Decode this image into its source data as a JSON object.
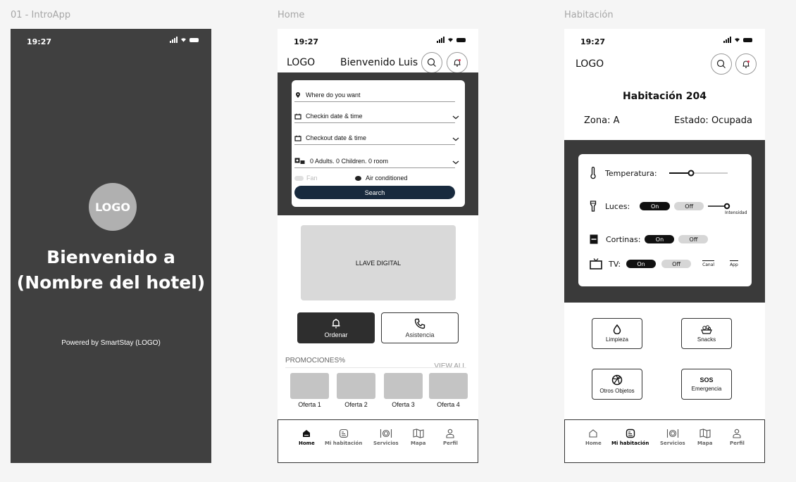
{
  "frames": {
    "intro_label": "01 - IntroApp",
    "home_label": "Home",
    "room_label": "Habitación"
  },
  "status": {
    "time": "19:27"
  },
  "intro": {
    "logo": "LOGO",
    "welcome_line1": "Bienvenido a",
    "welcome_line2": "(Nombre del hotel)",
    "powered": "Powered by SmartStay (LOGO)"
  },
  "home": {
    "logo": "LOGO",
    "welcome": "Bienvenido Luis",
    "search": {
      "where": "Where do you want",
      "checkin": "Checkin date & time",
      "checkout": "Checkout date & time",
      "guests": "0 Adults.   0 Children.   0 room",
      "fan": "Fan",
      "air": "Air conditioned",
      "button": "Search"
    },
    "llave": "LLAVE DIGITAL",
    "ordenar": "Ordenar",
    "asistencia": "Asistencia",
    "promos_title": "PROMOCIONES%",
    "view_all": "VIEW ALL",
    "offers": [
      "Oferta 1",
      "Oferta 2",
      "Oferta 3",
      "Oferta 4"
    ]
  },
  "tabs": [
    "Home",
    "Mi habitación",
    "Servicios",
    "Mapa",
    "Perfil"
  ],
  "room": {
    "logo": "LOGO",
    "title": "Habitación 204",
    "zona": "Zona: A",
    "estado": "Estado: Ocupada",
    "temperatura": "Temperatura:",
    "luces": "Luces:",
    "intensidad": "Intensidad",
    "cortinas": "Cortinas:",
    "tv": "TV:",
    "on": "On",
    "off": "Off",
    "canal": "Canal",
    "app": "App",
    "services": {
      "limpieza": "Limpieza",
      "snacks": "Snacks",
      "otros": "Otros Objetos",
      "sos": "SOS",
      "emergencia": "Emergencia"
    }
  }
}
